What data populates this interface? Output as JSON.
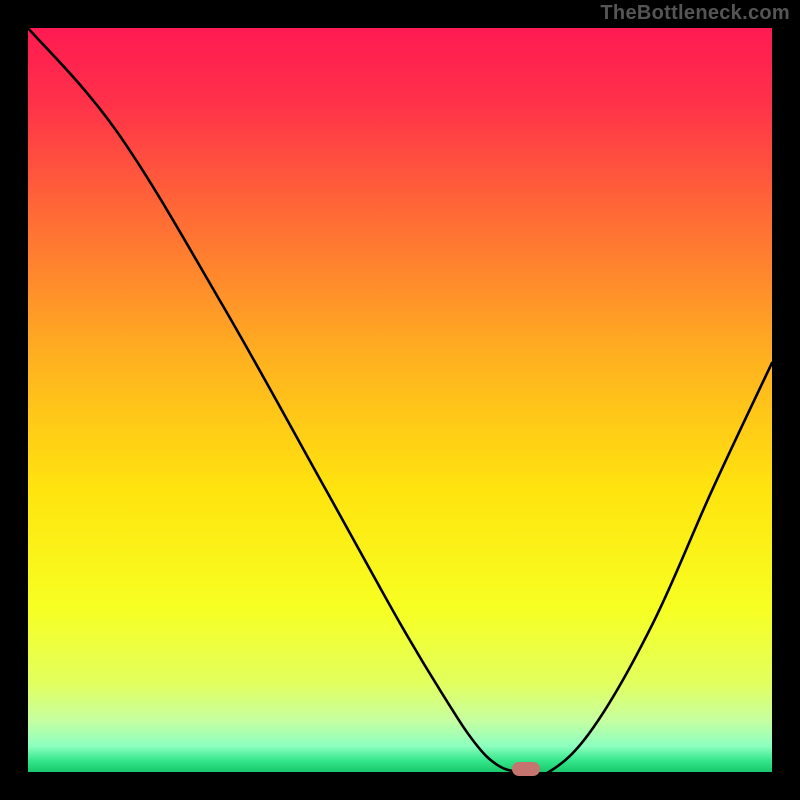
{
  "watermark": "TheBottleneck.com",
  "colors": {
    "frame": "#000000",
    "gradient_stops": [
      {
        "offset": 0.0,
        "color": "#ff1a52"
      },
      {
        "offset": 0.1,
        "color": "#ff3149"
      },
      {
        "offset": 0.25,
        "color": "#ff6a36"
      },
      {
        "offset": 0.45,
        "color": "#ffb31f"
      },
      {
        "offset": 0.62,
        "color": "#ffe40e"
      },
      {
        "offset": 0.78,
        "color": "#f7ff22"
      },
      {
        "offset": 0.88,
        "color": "#e2ff5e"
      },
      {
        "offset": 0.93,
        "color": "#c7ffa0"
      },
      {
        "offset": 0.965,
        "color": "#8dffc0"
      },
      {
        "offset": 0.985,
        "color": "#34e68b"
      },
      {
        "offset": 1.0,
        "color": "#18c86a"
      }
    ],
    "curve": "#000000",
    "marker": "#c4736f"
  },
  "chart_data": {
    "type": "line",
    "title": "",
    "xlabel": "",
    "ylabel": "",
    "xlim": [
      0,
      100
    ],
    "ylim": [
      0,
      100
    ],
    "grid": false,
    "legend": false,
    "series": [
      {
        "name": "bottleneck-curve",
        "x": [
          0,
          12,
          26,
          40,
          50,
          56,
          60,
          63,
          66,
          70,
          76,
          84,
          92,
          100
        ],
        "values": [
          100,
          86,
          63,
          38,
          20,
          10,
          4,
          1,
          0,
          0,
          6,
          20,
          38,
          55
        ]
      }
    ],
    "annotations": [
      {
        "name": "optimal-marker",
        "x": 67,
        "y": 0,
        "shape": "pill",
        "color": "#c4736f"
      }
    ]
  }
}
